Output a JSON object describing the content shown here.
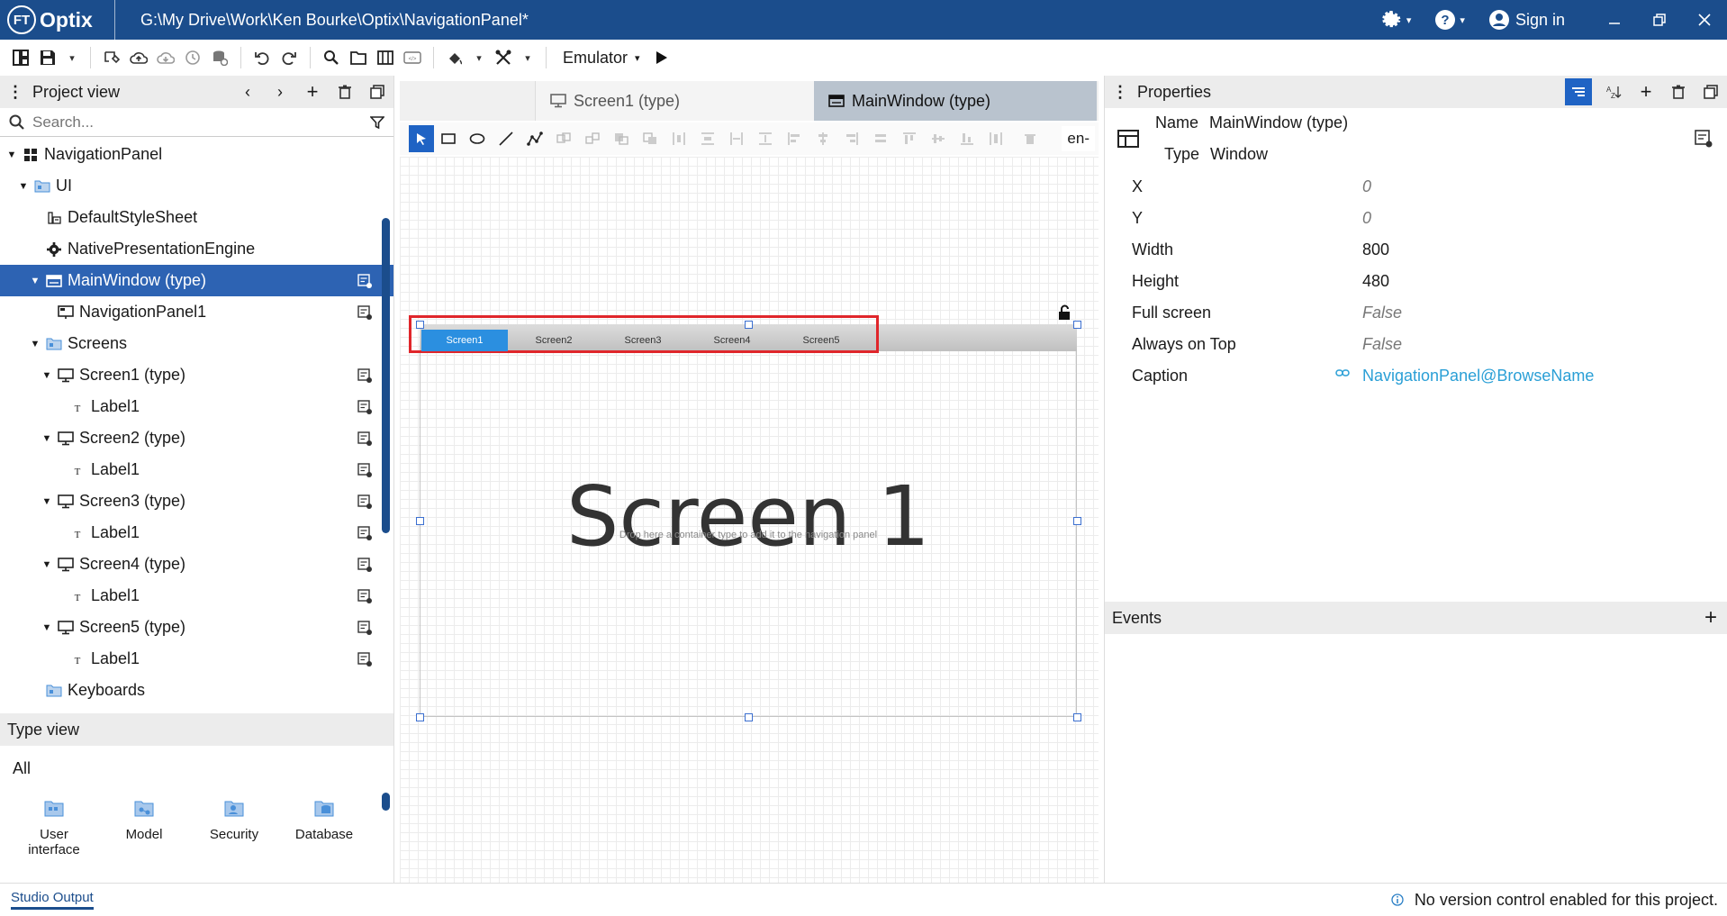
{
  "titlebar": {
    "logo_mark": "FT",
    "brand": "Optix",
    "file_path": "G:\\My Drive\\Work\\Ken Bourke\\Optix\\NavigationPanel*",
    "signin": "Sign in"
  },
  "toolbar": {
    "emulator_label": "Emulator"
  },
  "project_view": {
    "title": "Project view",
    "search_placeholder": "Search...",
    "tree": [
      {
        "label": "NavigationPanel",
        "level": 0,
        "arrow": "down",
        "icon": "project-icon"
      },
      {
        "label": "UI",
        "level": 1,
        "arrow": "down",
        "icon": "folder-ui-icon"
      },
      {
        "label": "DefaultStyleSheet",
        "level": 2,
        "arrow": "none",
        "icon": "stylesheet-icon"
      },
      {
        "label": "NativePresentationEngine",
        "level": 2,
        "arrow": "none",
        "icon": "gear-icon"
      },
      {
        "label": "MainWindow (type)",
        "level": 2,
        "arrow": "down",
        "icon": "window-icon",
        "selected": true,
        "edit": true
      },
      {
        "label": "NavigationPanel1",
        "level": 3,
        "arrow": "none",
        "icon": "navpanel-icon",
        "edit": true
      },
      {
        "label": "Screens",
        "level": 2,
        "arrow": "down",
        "icon": "folder-screens-icon"
      },
      {
        "label": "Screen1 (type)",
        "level": 3,
        "arrow": "down",
        "icon": "screen-icon",
        "edit": true
      },
      {
        "label": "Label1",
        "level": 4,
        "arrow": "none",
        "icon": "label-icon",
        "edit": true
      },
      {
        "label": "Screen2 (type)",
        "level": 3,
        "arrow": "down",
        "icon": "screen-icon",
        "edit": true
      },
      {
        "label": "Label1",
        "level": 4,
        "arrow": "none",
        "icon": "label-icon",
        "edit": true
      },
      {
        "label": "Screen3 (type)",
        "level": 3,
        "arrow": "down",
        "icon": "screen-icon",
        "edit": true
      },
      {
        "label": "Label1",
        "level": 4,
        "arrow": "none",
        "icon": "label-icon",
        "edit": true
      },
      {
        "label": "Screen4 (type)",
        "level": 3,
        "arrow": "down",
        "icon": "screen-icon",
        "edit": true
      },
      {
        "label": "Label1",
        "level": 4,
        "arrow": "none",
        "icon": "label-icon",
        "edit": true
      },
      {
        "label": "Screen5 (type)",
        "level": 3,
        "arrow": "down",
        "icon": "screen-icon",
        "edit": true
      },
      {
        "label": "Label1",
        "level": 4,
        "arrow": "none",
        "icon": "label-icon",
        "edit": true
      },
      {
        "label": "Keyboards",
        "level": 2,
        "arrow": "none",
        "icon": "folder-keyboards-icon"
      }
    ]
  },
  "type_view": {
    "title": "Type view",
    "filter": "All",
    "items": [
      {
        "label": "User interface",
        "icon": "user-interface-icon"
      },
      {
        "label": "Model",
        "icon": "model-icon"
      },
      {
        "label": "Security",
        "icon": "security-icon"
      },
      {
        "label": "Database",
        "icon": "database-icon"
      }
    ]
  },
  "editor": {
    "tabs": [
      {
        "label": "Screen1 (type)",
        "active": false
      },
      {
        "label": "MainWindow (type)",
        "active": true
      }
    ],
    "locale": "en-",
    "nav_tabs": [
      "Screen1",
      "Screen2",
      "Screen3",
      "Screen4",
      "Screen5"
    ],
    "active_nav_tab": "Screen1",
    "screen_text": "Screen 1",
    "drop_hint": "Drop here a container type to add it to the navigation panel"
  },
  "properties": {
    "title": "Properties",
    "name_label": "Name",
    "name_value": "MainWindow (type)",
    "type_label": "Type",
    "type_value": "Window",
    "rows": [
      {
        "key": "X",
        "value": "0",
        "style": "default"
      },
      {
        "key": "Y",
        "value": "0",
        "style": "default"
      },
      {
        "key": "Width",
        "value": "800",
        "style": "set"
      },
      {
        "key": "Height",
        "value": "480",
        "style": "set"
      },
      {
        "key": "Full screen",
        "value": "False",
        "style": "default"
      },
      {
        "key": "Always on Top",
        "value": "False",
        "style": "default"
      },
      {
        "key": "Caption",
        "value": "NavigationPanel@BrowseName",
        "style": "link"
      }
    ]
  },
  "events": {
    "title": "Events"
  },
  "status": {
    "studio_output": "Studio Output",
    "message": "No version control enabled for this project."
  },
  "colors": {
    "titlebar": "#1b4d8c",
    "selection": "#2d63b3",
    "accent": "#1f63c4",
    "link": "#2a9fd6",
    "highlight_box": "#e0262b",
    "nav_active": "#2b8fe0"
  }
}
